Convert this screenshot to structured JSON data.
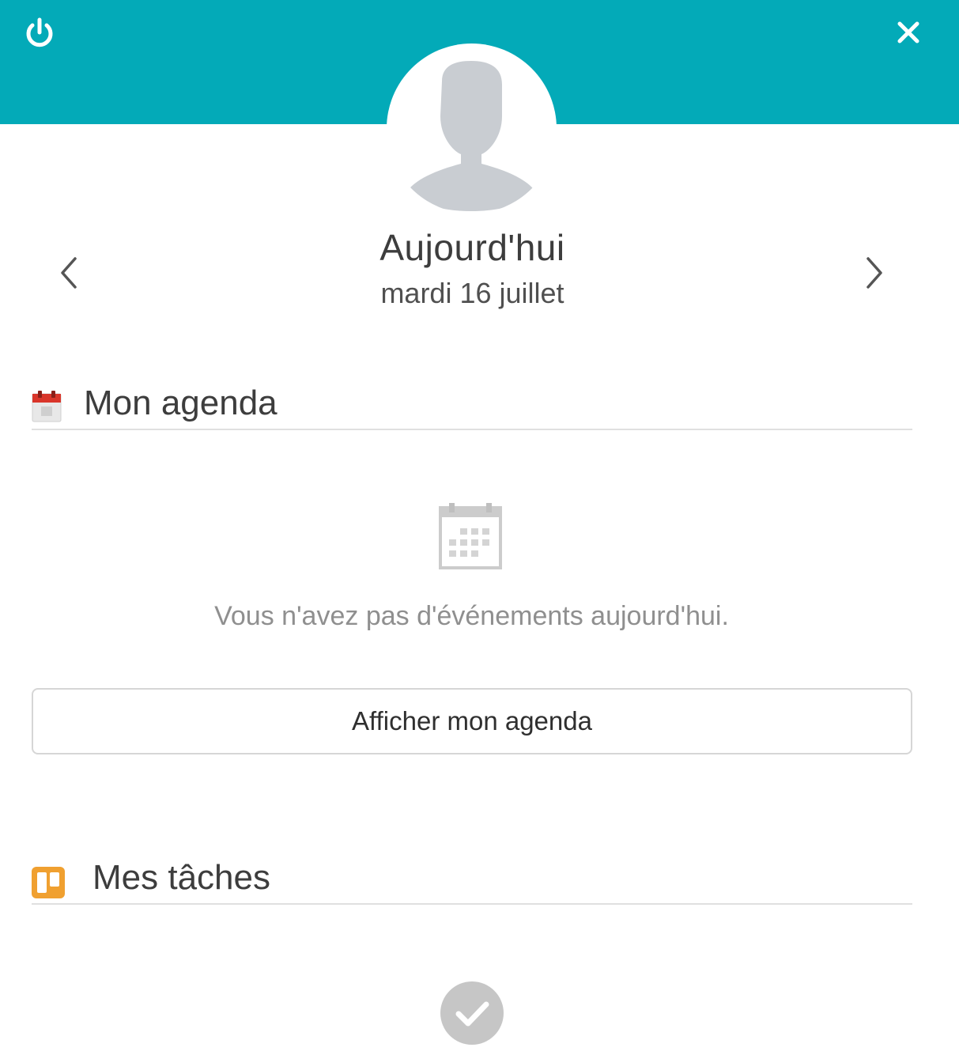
{
  "header": {
    "color": "#03aab8",
    "power_icon": "power-icon",
    "close_icon": "close-icon"
  },
  "avatar": {
    "icon": "user-silhouette-icon",
    "color": "#c9cdd2"
  },
  "date_nav": {
    "title": "Aujourd'hui",
    "date": "mardi 16 juillet",
    "prev_icon": "chevron-left-icon",
    "next_icon": "chevron-right-icon"
  },
  "agenda": {
    "title": "Mon agenda",
    "icon": "calendar-icon",
    "icon_color": "#d9352a",
    "empty_icon": "calendar-outline-icon",
    "empty_message": "Vous n'avez pas d'événements aujourd'hui.",
    "show_button_label": "Afficher mon agenda"
  },
  "tasks": {
    "title": "Mes tâches",
    "icon": "kanban-board-icon",
    "icon_color": "#f0a030",
    "empty_icon": "check-circle-icon"
  }
}
